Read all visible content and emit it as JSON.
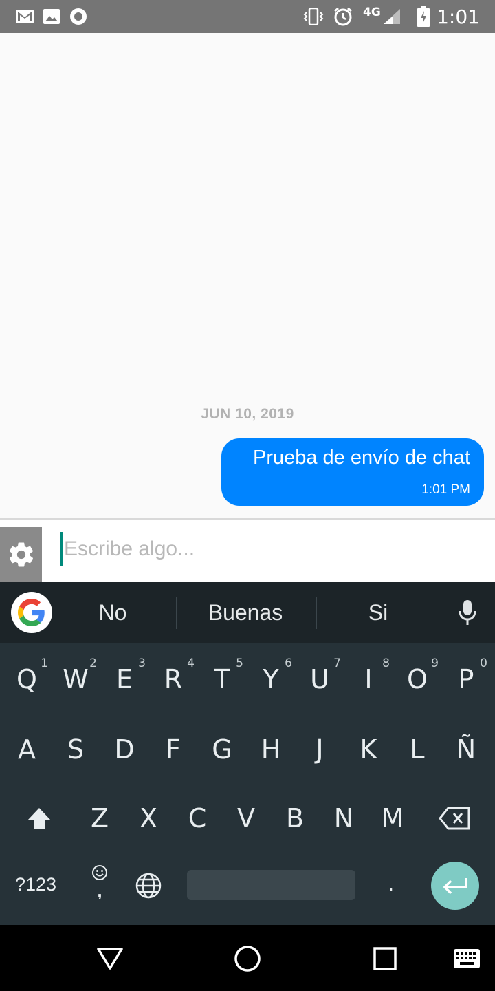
{
  "status_bar": {
    "time": "1:01",
    "network": "4G",
    "icons": [
      "gmail-icon",
      "image-icon",
      "record-icon",
      "vibrate-icon",
      "alarm-icon",
      "signal-icon",
      "battery-icon"
    ]
  },
  "chat": {
    "date_separator": "JUN 10, 2019",
    "messages": [
      {
        "text": "Prueba de envío de chat",
        "time": "1:01 PM",
        "outgoing": true
      }
    ],
    "bubble_color": "#0084ff"
  },
  "composer": {
    "placeholder": "Escribe algo...",
    "value": "",
    "settings_icon": "gear-icon"
  },
  "keyboard": {
    "suggestions": [
      "No",
      "Buenas",
      "Si"
    ],
    "row1": [
      {
        "label": "Q",
        "hint": "1"
      },
      {
        "label": "W",
        "hint": "2"
      },
      {
        "label": "E",
        "hint": "3"
      },
      {
        "label": "R",
        "hint": "4"
      },
      {
        "label": "T",
        "hint": "5"
      },
      {
        "label": "Y",
        "hint": "6"
      },
      {
        "label": "U",
        "hint": "7"
      },
      {
        "label": "I",
        "hint": "8"
      },
      {
        "label": "O",
        "hint": "9"
      },
      {
        "label": "P",
        "hint": "0"
      }
    ],
    "row2": [
      "A",
      "S",
      "D",
      "F",
      "G",
      "H",
      "J",
      "K",
      "L",
      "Ñ"
    ],
    "row3": [
      "Z",
      "X",
      "C",
      "V",
      "B",
      "N",
      "M"
    ],
    "symbols_label": "?123",
    "emoji_comma": ",",
    "period": ".",
    "accent_color": "#7fcbc4"
  },
  "nav_bar": {
    "buttons": [
      "back-icon",
      "home-icon",
      "recents-icon",
      "keyboard-switch-icon"
    ]
  }
}
